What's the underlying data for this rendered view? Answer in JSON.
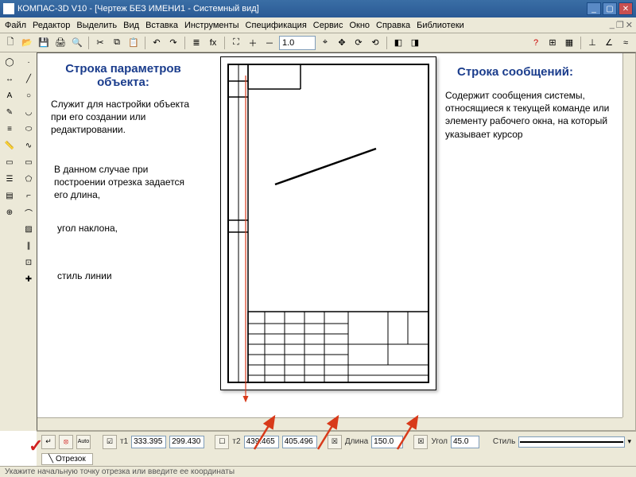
{
  "titlebar": {
    "text": "КОМПАС-3D V10 - [Чертеж БЕЗ ИМЕНИ1 - Системный вид]"
  },
  "menu": {
    "items": [
      "Файл",
      "Редактор",
      "Выделить",
      "Вид",
      "Вставка",
      "Инструменты",
      "Спецификация",
      "Сервис",
      "Окно",
      "Справка",
      "Библиотеки"
    ]
  },
  "toolbar": {
    "zoom": "1.0"
  },
  "parambar": {
    "t1_label": "т1",
    "t1_x": "333.395",
    "t1_y": "299.430",
    "t2_label": "т2",
    "t2_x": "439.465",
    "t2_y": "405.496",
    "length_label": "Длина",
    "length_val": "150.0",
    "angle_label": "Угол",
    "angle_val": "45.0",
    "style_label": "Стиль"
  },
  "tab": {
    "label": "Отрезок"
  },
  "status": {
    "text": "Укажите начальную точку отрезка или введите ее координаты"
  },
  "annotations": {
    "param_title": "Строка параметров объекта:",
    "param_p1": "Служит для настройки объекта при его создании или редактировании.",
    "param_p2": "В данном случае при построении отрезка задается его длина,",
    "param_p3": "угол наклона,",
    "param_p4": "стиль линии",
    "msg_title": "Строка сообщений:",
    "msg_body": "Содержит сообщения системы, относящиеся к текущей команде или элементу рабочего окна, на который  указывает курсор"
  }
}
